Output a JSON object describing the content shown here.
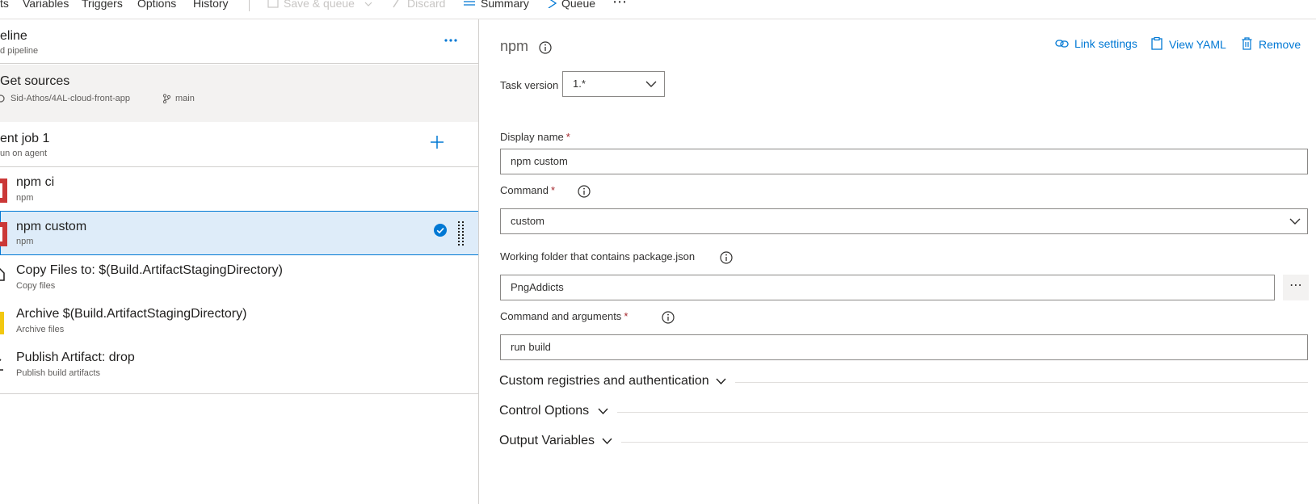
{
  "toolbar": {
    "tab_tasks": "ts",
    "tab_variables": "Variables",
    "tab_triggers": "Triggers",
    "tab_options": "Options",
    "tab_history": "History",
    "save_queue": "Save & queue",
    "discard": "Discard",
    "summary": "Summary",
    "queue": "Queue",
    "more": "⋯"
  },
  "pipeline": {
    "title": "eline",
    "subtitle": "d pipeline"
  },
  "get_sources": {
    "title": "Get sources",
    "repo": "Sid-Athos/4AL-cloud-front-app",
    "branch": "main"
  },
  "agent_job": {
    "title": "ent job 1",
    "subtitle": "un on agent"
  },
  "tasks": [
    {
      "title": "npm ci",
      "subtitle": "npm"
    },
    {
      "title": "npm custom",
      "subtitle": "npm"
    },
    {
      "title": "Copy Files to: $(Build.ArtifactStagingDirectory)",
      "subtitle": "Copy files"
    },
    {
      "title": "Archive $(Build.ArtifactStagingDirectory)",
      "subtitle": "Archive files"
    },
    {
      "title": "Publish Artifact: drop",
      "subtitle": "Publish build artifacts"
    }
  ],
  "detail": {
    "title": "npm",
    "link_settings": "Link settings",
    "view_yaml": "View YAML",
    "remove": "Remove",
    "task_version_label": "Task version",
    "task_version_value": "1.*",
    "display_name_label": "Display name",
    "display_name_value": "npm custom",
    "command_label": "Command",
    "command_value": "custom",
    "working_folder_label": "Working folder that contains package.json",
    "working_folder_value": "PngAddicts",
    "command_args_label": "Command and arguments",
    "command_args_value": "run build",
    "required_marker": "*",
    "ellipsis": "⋯",
    "section_registries": "Custom registries and authentication",
    "section_control": "Control Options",
    "section_output": "Output Variables"
  },
  "colors": {
    "accent": "#0078d4",
    "selected_bg": "#deecf9",
    "npm_red": "#cb3837",
    "required": "#a4262c"
  }
}
